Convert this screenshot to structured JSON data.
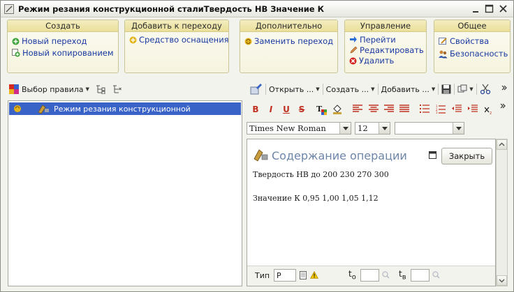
{
  "window": {
    "title": "Режим резания конструкционной сталиТвердость НВ Значение К"
  },
  "groups": [
    {
      "title": "Создать",
      "items": [
        "Новый переход",
        "Новый копированием"
      ]
    },
    {
      "title": "Добавить к переходу",
      "items": [
        "Средство оснащения"
      ]
    },
    {
      "title": "Дополнительно",
      "items": [
        "Заменить переход"
      ]
    },
    {
      "title": "Управление",
      "items": [
        "Перейти",
        "Редактировать",
        "Удалить"
      ]
    },
    {
      "title": "Общее",
      "items": [
        "Свойства",
        "Безопасность"
      ]
    }
  ],
  "left_toolbar": {
    "select_rule": "Выбор правила"
  },
  "tree": {
    "rows": [
      {
        "label": "Режим резания конструкционной"
      }
    ]
  },
  "right_toolbar": {
    "open": "Открыть ...",
    "create": "Создать ...",
    "add": "Добавить ..."
  },
  "format": {
    "font": "Times New Roman",
    "size": "12",
    "style": ""
  },
  "editor": {
    "title": "Содержание операции",
    "close_label": "Закрыть",
    "line1": "Твердость НВ до 200 230 270 300",
    "line2": "Значение К 0,95 1,00 1,05 1,12"
  },
  "footer": {
    "type_label": "Тип",
    "type_value": "Р",
    "t0_main": "t",
    "t0_sub": "о",
    "tv_main": "t",
    "tv_sub": "в",
    "t0_value": "",
    "tv_value": ""
  },
  "colors": {
    "selection": "#3a63c7",
    "link": "#1a3aa0",
    "group_header": "#eadf9a",
    "editor_title": "#6d86a8"
  }
}
